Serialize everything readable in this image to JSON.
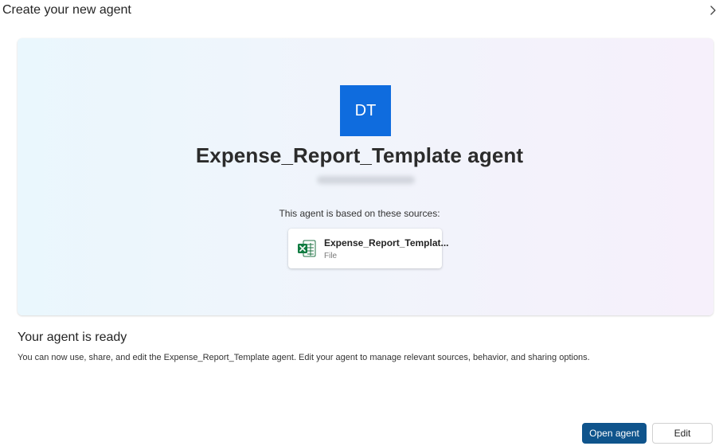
{
  "header": {
    "title": "Create your new agent",
    "chevron_icon": "chevron-right-icon"
  },
  "agent": {
    "avatar_initials": "DT",
    "avatar_color": "#0f6cde",
    "name": "Expense_Report_Template agent",
    "sources_label": "This agent is based on these sources:",
    "source": {
      "icon": "excel-file-icon",
      "name": "Expense_Report_Templat...",
      "type": "File"
    }
  },
  "ready": {
    "title": "Your agent is ready",
    "description": "You can now use, share, and edit the Expense_Report_Template agent. Edit your agent to manage relevant sources, behavior, and sharing options."
  },
  "actions": {
    "open_label": "Open agent",
    "edit_label": "Edit",
    "primary_color": "#0f548c"
  }
}
